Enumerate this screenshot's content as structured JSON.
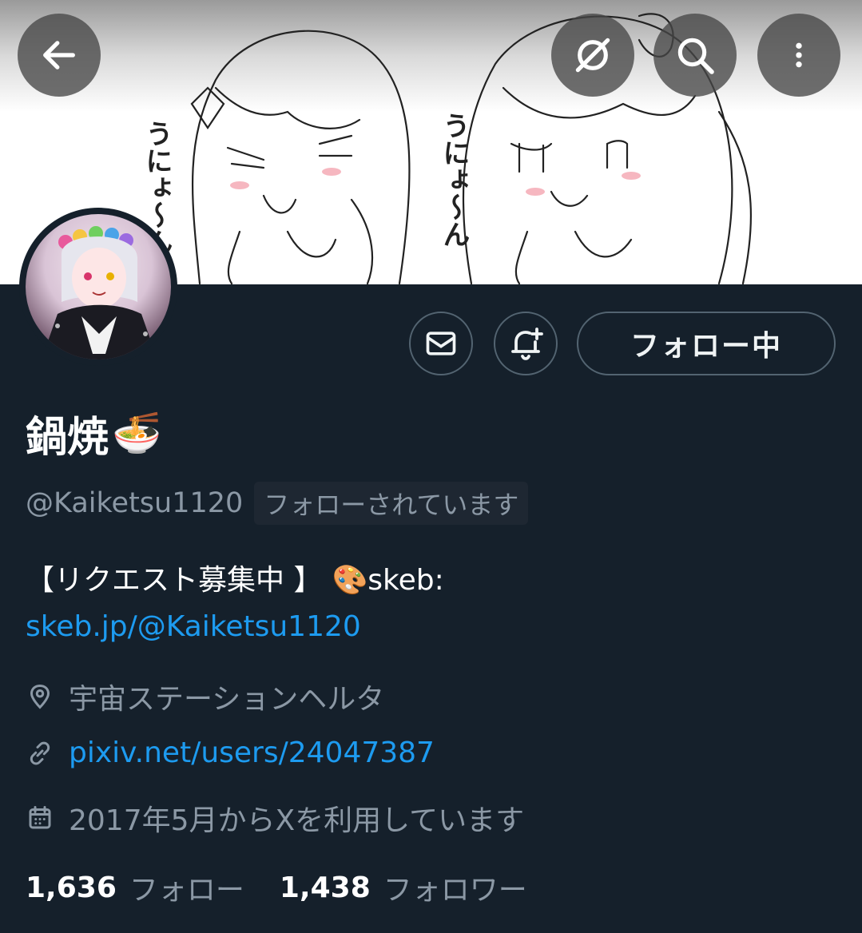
{
  "banner": {
    "text_left": "うにょ〜ん",
    "text_right": "うにょ〜ん"
  },
  "header": {
    "back_icon": "arrow-left-icon",
    "grok_icon": "grok-icon",
    "search_icon": "search-icon",
    "more_icon": "more-vertical-icon"
  },
  "actions": {
    "message_icon": "envelope-icon",
    "notify_icon": "bell-plus-icon",
    "follow_label": "フォロー中"
  },
  "profile": {
    "display_name": "鍋焼",
    "display_emoji": "🍜",
    "handle": "@Kaiketsu1120",
    "follows_you": "フォローされています",
    "bio_line1_text": "【リクエスト募集中 】",
    "bio_line1_emoji": "🎨",
    "bio_line1_suffix": "skeb:",
    "bio_link": "skeb.jp/@Kaiketsu1120",
    "location": "宇宙ステーションヘルタ",
    "website": "pixiv.net/users/24047387",
    "joined": "2017年5月からXを利用しています",
    "following_count": "1,636",
    "following_label": "フォロー",
    "followers_count": "1,438",
    "followers_label": "フォロワー"
  },
  "colors": {
    "background": "#15202b",
    "accent": "#1d9bf0",
    "muted": "#8b98a5",
    "border": "#536471"
  }
}
